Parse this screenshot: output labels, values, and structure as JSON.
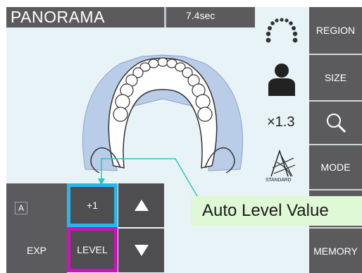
{
  "header": {
    "mode_title": "PANORAMA",
    "exposure_time": "7.4sec"
  },
  "side_panel": {
    "region_label": "REGION",
    "size_label": "SIZE",
    "magnification": "×1.3",
    "mode_label": "MODE",
    "mode_icon_caption": "STANDARD",
    "memory_label": "MEMORY"
  },
  "controls": {
    "a_badge": "A",
    "level_value": "+1",
    "exp_label": "EXP",
    "level_label": "LEVEL"
  },
  "annotation": {
    "callout_text": "Auto Level Value"
  },
  "colors": {
    "panel": "#5b5b5d",
    "screen_bg": "#e8f3f8",
    "value_highlight": "#29b6ea",
    "level_highlight": "#d10fbf",
    "callout_bg": "#dff8d6",
    "callout_line": "#29c9b8"
  }
}
